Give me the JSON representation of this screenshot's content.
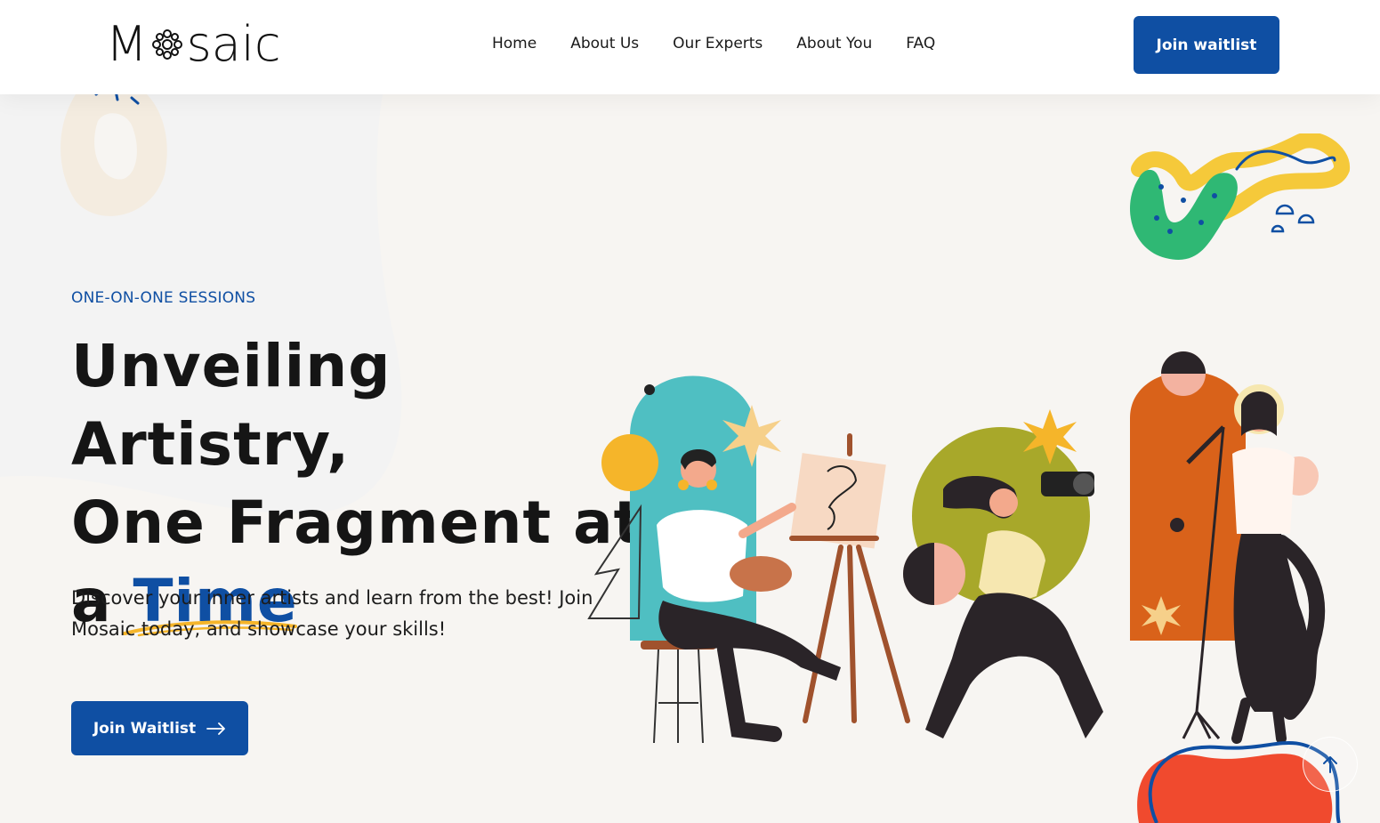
{
  "header": {
    "logo_left": "M",
    "logo_right": "saic",
    "nav": [
      {
        "label": "Home"
      },
      {
        "label": "About Us"
      },
      {
        "label": "Our Experts"
      },
      {
        "label": "About You"
      },
      {
        "label": "FAQ"
      }
    ],
    "cta_label": "Join waitlist"
  },
  "hero": {
    "eyebrow": "ONE-ON-ONE SESSIONS",
    "headline_line1": "Unveiling Artistry,",
    "headline_line2": "One Fragment at",
    "headline_line3_prefix": "a ",
    "headline_accent": "Time",
    "subtext": "Discover your inner artists and learn from the best! Join Mosaic today, and showcase your skills!",
    "cta_label": "Join Waitlist"
  },
  "colors": {
    "brand_blue": "#0f4fa3",
    "accent_yellow": "#f5b52a",
    "teal": "#4fbfc2",
    "orange": "#d9621a",
    "olive": "#a8a82a",
    "red": "#f04a2e",
    "green": "#2fb874"
  },
  "icons": {
    "logo_mark": "mosaic-flower-icon",
    "cta_arrow": "arrow-right-icon",
    "scroll": "arrow-up-icon"
  }
}
